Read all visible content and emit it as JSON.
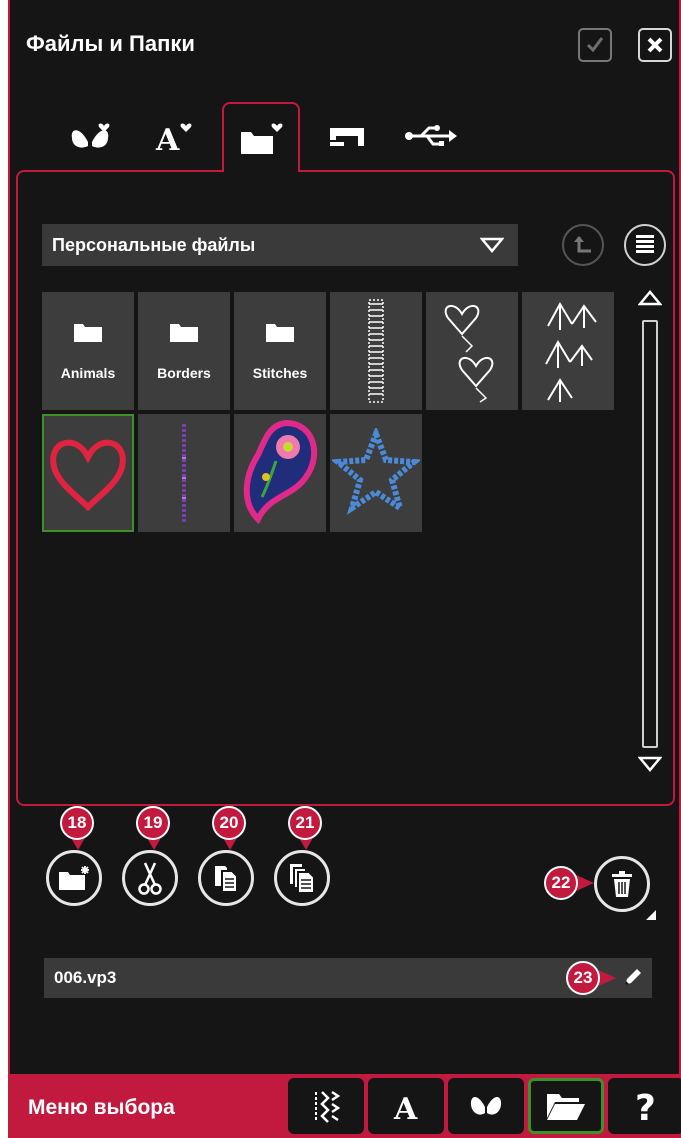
{
  "window": {
    "title": "Файлы и Папки",
    "ok_icon": "checkmark-icon",
    "close_icon": "close-icon"
  },
  "tabs": [
    {
      "icon": "butterfly-heart-icon",
      "active": false
    },
    {
      "icon": "font-heart-icon",
      "active": false
    },
    {
      "icon": "folder-heart-icon",
      "active": true
    },
    {
      "icon": "sewing-machine-icon",
      "active": false
    },
    {
      "icon": "usb-icon",
      "active": false
    }
  ],
  "browser": {
    "location": "Персональные файлы",
    "folders": [
      "Animals",
      "Borders",
      "Stitches"
    ],
    "files": [
      {
        "icon": "stitch-column-thumbnail"
      },
      {
        "icon": "hearts-border-thumbnail"
      },
      {
        "icon": "chevron-stitch-thumbnail"
      },
      {
        "icon": "red-heart-thumbnail",
        "selected": true
      },
      {
        "icon": "purple-text-stitch-thumbnail"
      },
      {
        "icon": "paisley-flower-thumbnail"
      },
      {
        "icon": "blue-star-thumbnail"
      }
    ]
  },
  "actions": {
    "badges": {
      "new_folder": "18",
      "cut": "19",
      "copy": "20",
      "paste": "21",
      "delete": "22",
      "rename": "23"
    }
  },
  "filename": {
    "value": "006.vp3"
  },
  "footer": {
    "label": "Меню выбора",
    "buttons": [
      "stitch-menu-icon",
      "font-icon",
      "butterfly-icon",
      "open-folder-icon",
      "help-icon"
    ]
  },
  "colors": {
    "accent": "#c2193f",
    "selected": "#3f8f2a",
    "background": "#151515"
  }
}
